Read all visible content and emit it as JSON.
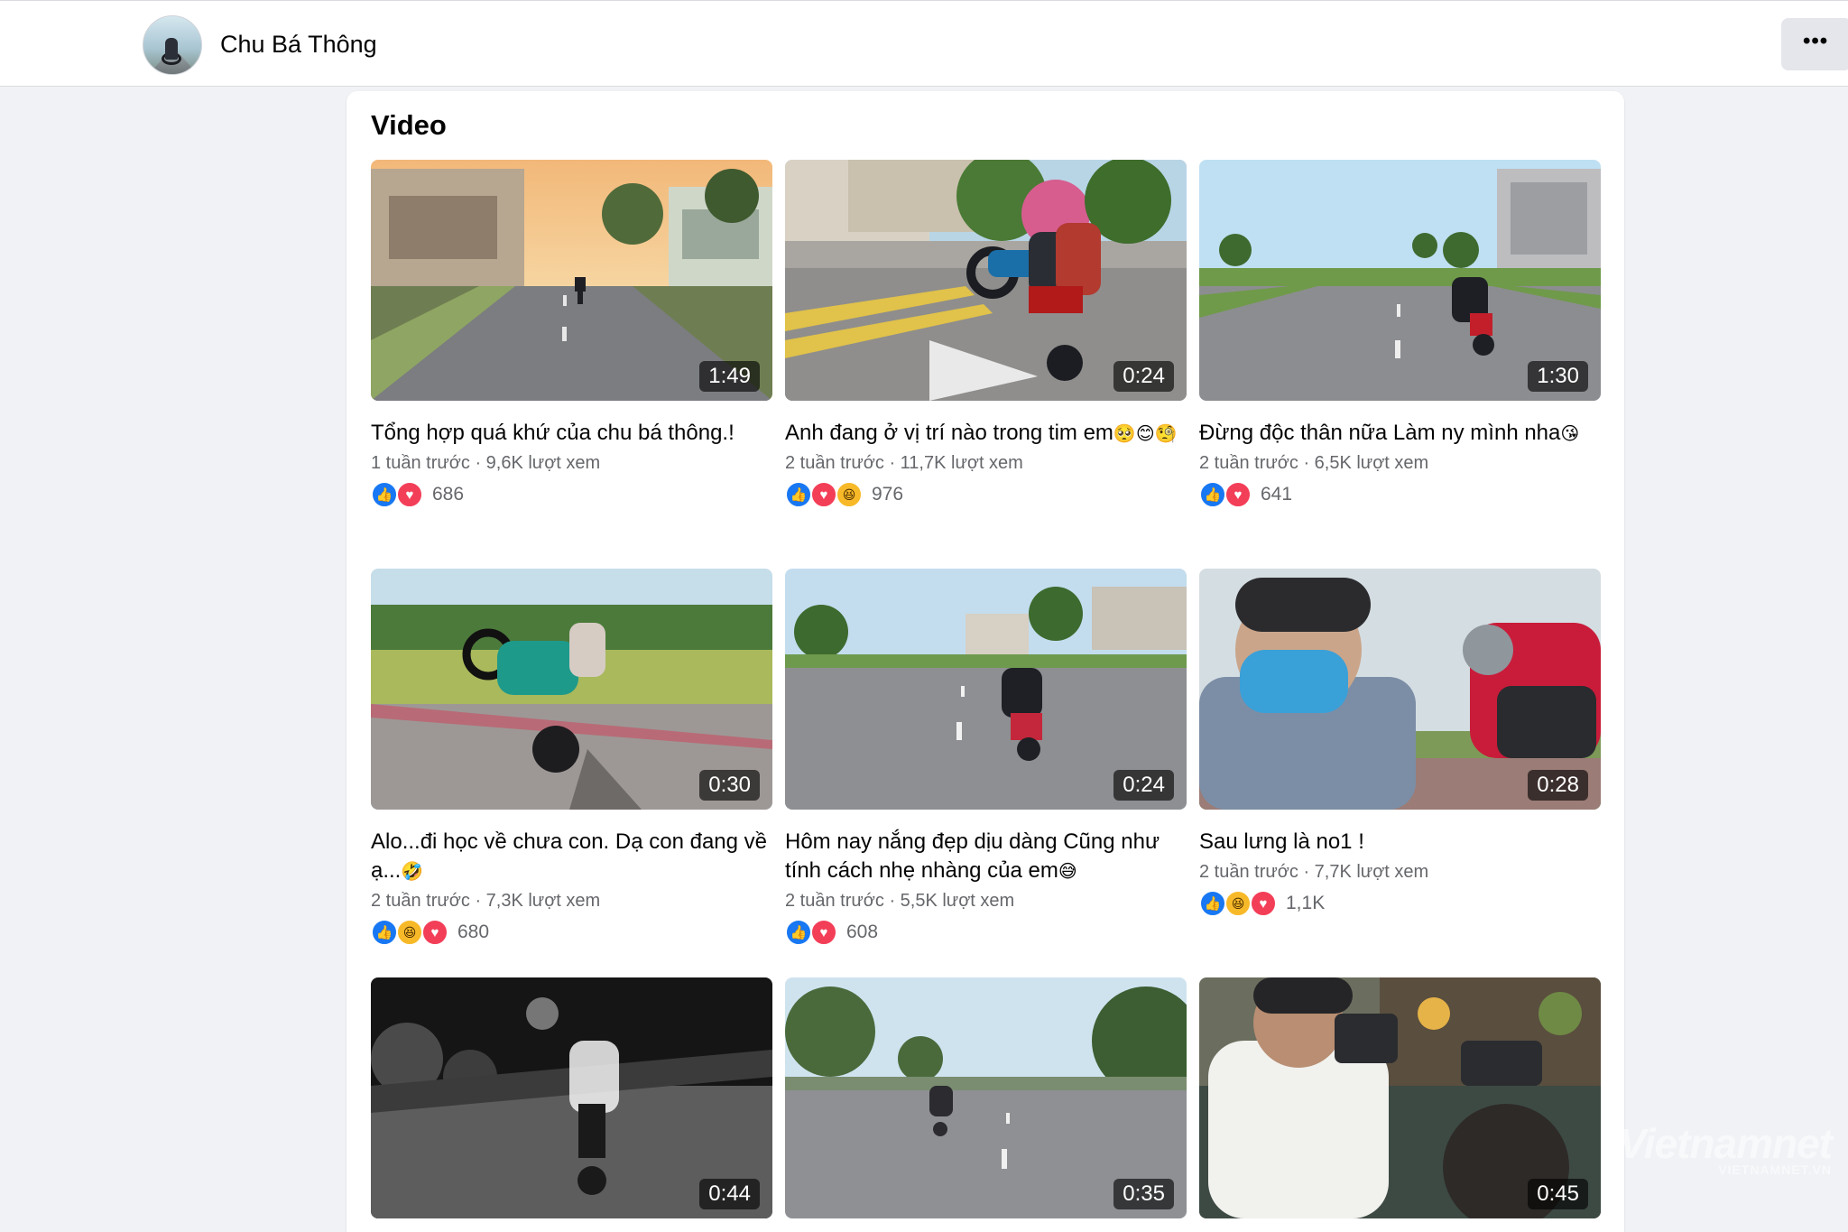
{
  "header": {
    "profile_name": "Chu Bá Thông",
    "more_label": "•••"
  },
  "section": {
    "title": "Video"
  },
  "videos": [
    {
      "title": "Tổng hợp quá khứ của chu bá thông.!",
      "emoji": "",
      "meta": "1 tuần trước · 9,6K lượt xem",
      "duration": "1:49",
      "reactions": [
        "like",
        "love"
      ],
      "reaction_count": "686"
    },
    {
      "title": "Anh đang ở vị trí nào trong tim em",
      "emoji": "🥺😊🧐",
      "meta": "2 tuần trước · 11,7K lượt xem",
      "duration": "0:24",
      "reactions": [
        "like",
        "love",
        "haha"
      ],
      "reaction_count": "976"
    },
    {
      "title": "Đừng độc thân nữa Làm ny mình nha",
      "emoji": "😘",
      "meta": "2 tuần trước · 6,5K lượt xem",
      "duration": "1:30",
      "reactions": [
        "like",
        "love"
      ],
      "reaction_count": "641"
    },
    {
      "title": "Alo...đi học về chưa con. Dạ con đang về ạ...",
      "emoji": "🤣",
      "meta": "2 tuần trước · 7,3K lượt xem",
      "duration": "0:30",
      "reactions": [
        "like",
        "haha",
        "love"
      ],
      "reaction_count": "680"
    },
    {
      "title": "Hôm nay nắng đẹp dịu dàng Cũng như tính cách nhẹ nhàng của em",
      "emoji": "😅",
      "meta": "2 tuần trước · 5,5K lượt xem",
      "duration": "0:24",
      "reactions": [
        "like",
        "love"
      ],
      "reaction_count": "608"
    },
    {
      "title": "Sau lưng là no1 !",
      "emoji": "",
      "meta": "2 tuần trước · 7,7K lượt xem",
      "duration": "0:28",
      "reactions": [
        "like",
        "haha",
        "love"
      ],
      "reaction_count": "1,1K"
    },
    {
      "duration": "0:44"
    },
    {
      "duration": "0:35"
    },
    {
      "duration": "0:45"
    }
  ],
  "watermark": {
    "main": "Vietnamnet",
    "sub": "VIETNAMNET.VN"
  },
  "colors": {
    "accent": "#1877f2",
    "love": "#f33e58",
    "haha": "#f7b928",
    "secondary_text": "#65676b"
  },
  "icons": {
    "like": "thumbs-up-icon",
    "love": "heart-icon",
    "haha": "laugh-emoji-icon",
    "more": "more-dots-icon"
  }
}
